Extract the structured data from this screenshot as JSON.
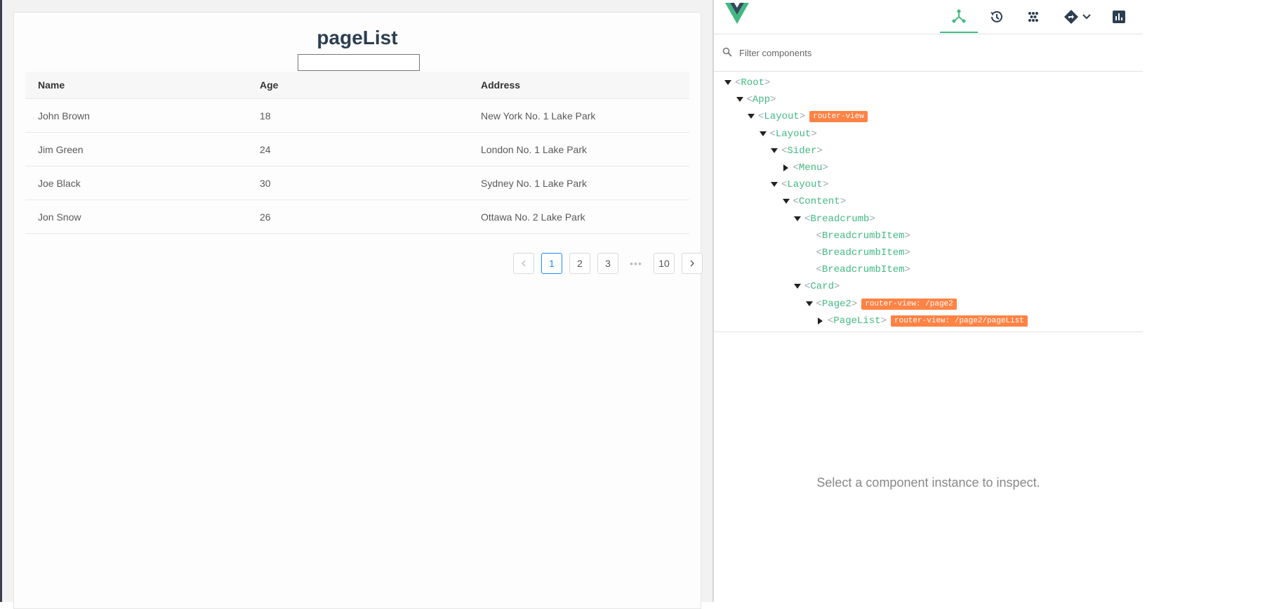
{
  "app": {
    "title": "pageList",
    "table": {
      "headers": [
        "Name",
        "Age",
        "Address"
      ],
      "rows": [
        [
          "John Brown",
          "18",
          "New York No. 1 Lake Park"
        ],
        [
          "Jim Green",
          "24",
          "London No. 1 Lake Park"
        ],
        [
          "Joe Black",
          "30",
          "Sydney No. 1 Lake Park"
        ],
        [
          "Jon Snow",
          "26",
          "Ottawa No. 2 Lake Park"
        ]
      ]
    },
    "pagination": {
      "pages": [
        "1",
        "2",
        "3",
        "•••",
        "10"
      ],
      "current": "1"
    }
  },
  "devtools": {
    "tabs": [
      "components-icon",
      "timeline-icon",
      "vuex-icon",
      "router-icon",
      "performance-icon"
    ],
    "active_tab": "components-icon",
    "accent": "#42b983",
    "filter_placeholder": "Filter components",
    "tree": [
      {
        "name": "Root",
        "expanded": true
      },
      {
        "name": "App",
        "expanded": true
      },
      {
        "name": "Layout",
        "expanded": true,
        "tag": "router-view"
      },
      {
        "name": "Layout",
        "expanded": true
      },
      {
        "name": "Sider",
        "expanded": true
      },
      {
        "name": "Menu",
        "expanded": false
      },
      {
        "name": "Layout",
        "expanded": true
      },
      {
        "name": "Content",
        "expanded": true
      },
      {
        "name": "Breadcrumb",
        "expanded": true
      },
      {
        "name": "BreadcrumbItem"
      },
      {
        "name": "BreadcrumbItem"
      },
      {
        "name": "BreadcrumbItem"
      },
      {
        "name": "Card",
        "expanded": true
      },
      {
        "name": "Page2",
        "expanded": true,
        "tag": "router-view: /page2"
      },
      {
        "name": "PageList",
        "expanded": false,
        "tag": "router-view: /page2/pageList"
      }
    ],
    "tag_color": "#ff8344",
    "inspect_message": "Select a component instance to inspect."
  }
}
